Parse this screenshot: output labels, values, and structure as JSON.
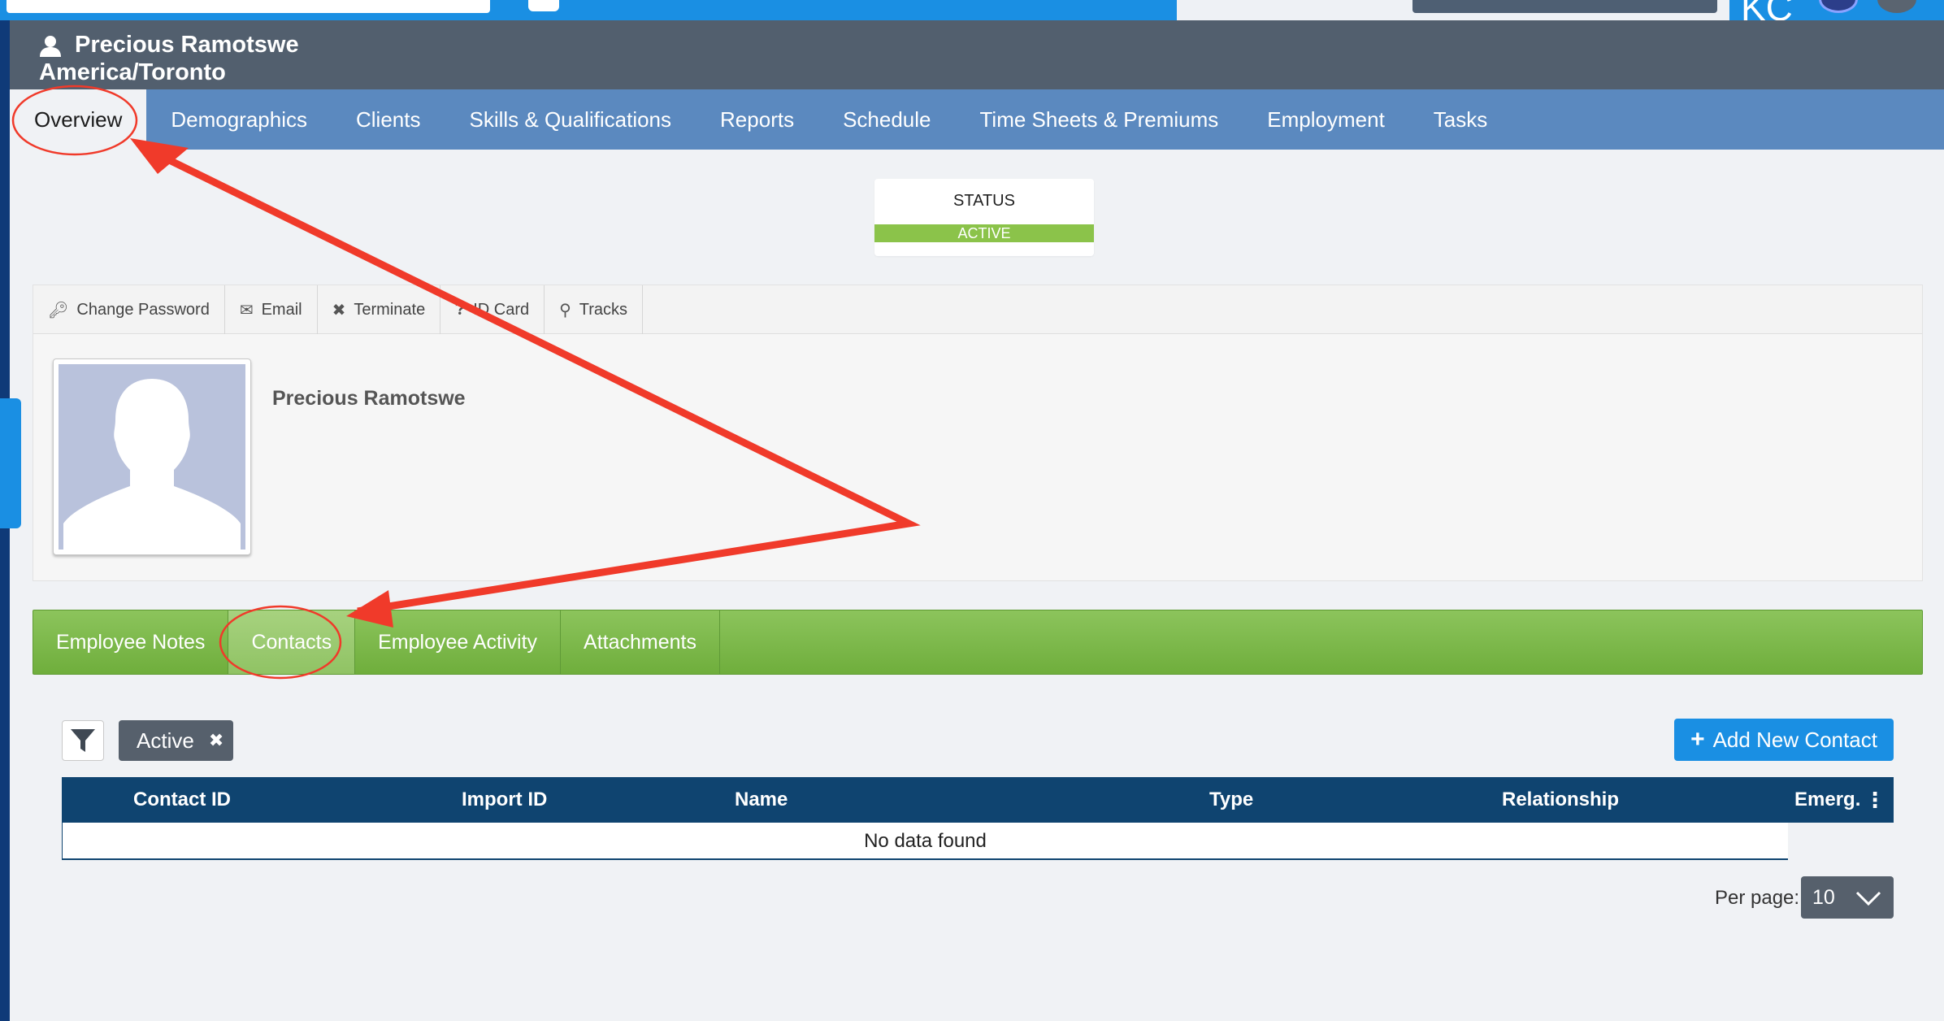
{
  "topbar": {
    "initials": "KC"
  },
  "person": {
    "name": "Precious Ramotswe",
    "timezone": "America/Toronto"
  },
  "nav": {
    "items": [
      {
        "label": "Overview"
      },
      {
        "label": "Demographics"
      },
      {
        "label": "Clients"
      },
      {
        "label": "Skills & Qualifications"
      },
      {
        "label": "Reports"
      },
      {
        "label": "Schedule"
      },
      {
        "label": "Time Sheets & Premiums"
      },
      {
        "label": "Employment"
      },
      {
        "label": "Tasks"
      }
    ],
    "active": "Overview"
  },
  "status": {
    "label": "STATUS",
    "value": "ACTIVE",
    "color": "#8bc34a"
  },
  "actions": [
    {
      "label": "Change Password",
      "icon": "key-icon"
    },
    {
      "label": "Email",
      "icon": "envelope-icon"
    },
    {
      "label": "Terminate",
      "icon": "close-icon"
    },
    {
      "label": "ID Card",
      "icon": "question-circle-icon"
    },
    {
      "label": "Tracks",
      "icon": "map-pin-icon"
    }
  ],
  "profile": {
    "name": "Precious Ramotswe"
  },
  "sub_tabs": {
    "items": [
      {
        "label": "Employee Notes"
      },
      {
        "label": "Contacts"
      },
      {
        "label": "Employee Activity"
      },
      {
        "label": "Attachments"
      }
    ],
    "active": "Contacts"
  },
  "filter": {
    "chip_label": "Active"
  },
  "add_button": {
    "label": "Add New Contact"
  },
  "table": {
    "columns": [
      "Contact ID",
      "Import ID",
      "Name",
      "Type",
      "Relationship",
      "Emerg."
    ],
    "empty_text": "No data found"
  },
  "pagination": {
    "per_page_label": "Per page:",
    "per_page_value": "10"
  },
  "colors": {
    "header_gray": "#525f6e",
    "nav_blue": "#5b89bf",
    "accent_blue": "#1a8fe3",
    "tab_green": "#7cbb48",
    "table_head": "#0f4470",
    "annotation_red": "#f03a2a"
  }
}
